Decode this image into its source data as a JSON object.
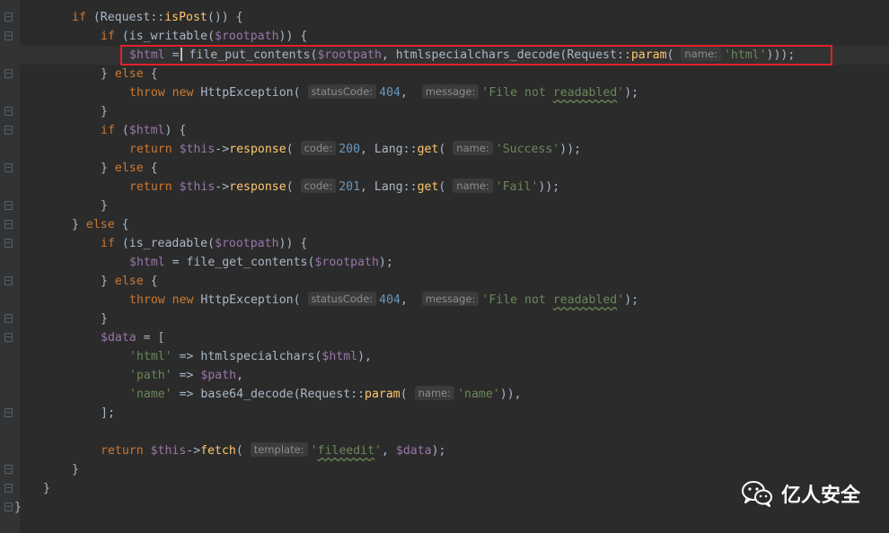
{
  "editor": {
    "lines": [
      {
        "indent": 80,
        "tokens": [
          {
            "t": "kw",
            "v": "if "
          },
          {
            "t": "plain",
            "v": "(Request::"
          },
          {
            "t": "fn",
            "v": "isPost"
          },
          {
            "t": "plain",
            "v": "()) {"
          }
        ]
      },
      {
        "indent": 112,
        "tokens": [
          {
            "t": "kw",
            "v": "if "
          },
          {
            "t": "plain",
            "v": "(is_writable("
          },
          {
            "t": "var",
            "v": "$rootpath"
          },
          {
            "t": "plain",
            "v": ")) {"
          }
        ]
      },
      {
        "indent": 144,
        "caret": true,
        "tokens": [
          {
            "t": "var",
            "v": "$html "
          },
          {
            "t": "plain",
            "v": "="
          },
          {
            "t": "caret"
          },
          {
            "t": "plain",
            "v": " file_put_contents("
          },
          {
            "t": "var",
            "v": "$rootpath"
          },
          {
            "t": "plain",
            "v": ", htmlspecialchars_decode(Request::"
          },
          {
            "t": "fn",
            "v": "param"
          },
          {
            "t": "plain",
            "v": "( "
          },
          {
            "t": "hint",
            "v": "name:"
          },
          {
            "t": "str",
            "v": "'html'"
          },
          {
            "t": "plain",
            "v": ")));"
          }
        ]
      },
      {
        "indent": 112,
        "tokens": [
          {
            "t": "plain",
            "v": "} "
          },
          {
            "t": "kw",
            "v": "else "
          },
          {
            "t": "plain",
            "v": "{"
          }
        ]
      },
      {
        "indent": 144,
        "tokens": [
          {
            "t": "kw",
            "v": "throw new "
          },
          {
            "t": "plain",
            "v": "HttpException( "
          },
          {
            "t": "hint",
            "v": "statusCode:"
          },
          {
            "t": "num",
            "v": "404"
          },
          {
            "t": "plain",
            "v": ",  "
          },
          {
            "t": "hint",
            "v": "message:"
          },
          {
            "t": "str",
            "v": "'File not "
          },
          {
            "t": "strsq",
            "v": "readabled"
          },
          {
            "t": "str",
            "v": "'"
          },
          {
            "t": "plain",
            "v": ");"
          }
        ]
      },
      {
        "indent": 112,
        "tokens": [
          {
            "t": "plain",
            "v": "}"
          }
        ]
      },
      {
        "indent": 112,
        "tokens": [
          {
            "t": "kw",
            "v": "if "
          },
          {
            "t": "plain",
            "v": "("
          },
          {
            "t": "var",
            "v": "$html"
          },
          {
            "t": "plain",
            "v": ") {"
          }
        ]
      },
      {
        "indent": 144,
        "tokens": [
          {
            "t": "kw",
            "v": "return "
          },
          {
            "t": "var",
            "v": "$this"
          },
          {
            "t": "plain",
            "v": "->"
          },
          {
            "t": "fn",
            "v": "response"
          },
          {
            "t": "plain",
            "v": "( "
          },
          {
            "t": "hint",
            "v": "code:"
          },
          {
            "t": "num",
            "v": "200"
          },
          {
            "t": "plain",
            "v": ", Lang::"
          },
          {
            "t": "fn",
            "v": "get"
          },
          {
            "t": "plain",
            "v": "( "
          },
          {
            "t": "hint",
            "v": "name:"
          },
          {
            "t": "str",
            "v": "'Success'"
          },
          {
            "t": "plain",
            "v": "));"
          }
        ]
      },
      {
        "indent": 112,
        "tokens": [
          {
            "t": "plain",
            "v": "} "
          },
          {
            "t": "kw",
            "v": "else "
          },
          {
            "t": "plain",
            "v": "{"
          }
        ]
      },
      {
        "indent": 144,
        "tokens": [
          {
            "t": "kw",
            "v": "return "
          },
          {
            "t": "var",
            "v": "$this"
          },
          {
            "t": "plain",
            "v": "->"
          },
          {
            "t": "fn",
            "v": "response"
          },
          {
            "t": "plain",
            "v": "( "
          },
          {
            "t": "hint",
            "v": "code:"
          },
          {
            "t": "num",
            "v": "201"
          },
          {
            "t": "plain",
            "v": ", Lang::"
          },
          {
            "t": "fn",
            "v": "get"
          },
          {
            "t": "plain",
            "v": "( "
          },
          {
            "t": "hint",
            "v": "name:"
          },
          {
            "t": "str",
            "v": "'Fail'"
          },
          {
            "t": "plain",
            "v": "));"
          }
        ]
      },
      {
        "indent": 112,
        "tokens": [
          {
            "t": "plain",
            "v": "}"
          }
        ]
      },
      {
        "indent": 80,
        "tokens": [
          {
            "t": "plain",
            "v": "} "
          },
          {
            "t": "kw",
            "v": "else "
          },
          {
            "t": "plain",
            "v": "{"
          }
        ]
      },
      {
        "indent": 112,
        "tokens": [
          {
            "t": "kw",
            "v": "if "
          },
          {
            "t": "plain",
            "v": "(is_readable("
          },
          {
            "t": "var",
            "v": "$rootpath"
          },
          {
            "t": "plain",
            "v": ")) {"
          }
        ]
      },
      {
        "indent": 144,
        "tokens": [
          {
            "t": "var",
            "v": "$html "
          },
          {
            "t": "plain",
            "v": "= file_get_contents("
          },
          {
            "t": "var",
            "v": "$rootpath"
          },
          {
            "t": "plain",
            "v": ");"
          }
        ]
      },
      {
        "indent": 112,
        "tokens": [
          {
            "t": "plain",
            "v": "} "
          },
          {
            "t": "kw",
            "v": "else "
          },
          {
            "t": "plain",
            "v": "{"
          }
        ]
      },
      {
        "indent": 144,
        "tokens": [
          {
            "t": "kw",
            "v": "throw new "
          },
          {
            "t": "plain",
            "v": "HttpException( "
          },
          {
            "t": "hint",
            "v": "statusCode:"
          },
          {
            "t": "num",
            "v": "404"
          },
          {
            "t": "plain",
            "v": ",  "
          },
          {
            "t": "hint",
            "v": "message:"
          },
          {
            "t": "str",
            "v": "'File not "
          },
          {
            "t": "strsq",
            "v": "readabled"
          },
          {
            "t": "str",
            "v": "'"
          },
          {
            "t": "plain",
            "v": ");"
          }
        ]
      },
      {
        "indent": 112,
        "tokens": [
          {
            "t": "plain",
            "v": "}"
          }
        ]
      },
      {
        "indent": 112,
        "tokens": [
          {
            "t": "var",
            "v": "$data "
          },
          {
            "t": "plain",
            "v": "= ["
          }
        ]
      },
      {
        "indent": 144,
        "tokens": [
          {
            "t": "str",
            "v": "'html' "
          },
          {
            "t": "plain",
            "v": "=> htmlspecialchars("
          },
          {
            "t": "var",
            "v": "$html"
          },
          {
            "t": "plain",
            "v": "),"
          }
        ]
      },
      {
        "indent": 144,
        "tokens": [
          {
            "t": "str",
            "v": "'path' "
          },
          {
            "t": "plain",
            "v": "=> "
          },
          {
            "t": "var",
            "v": "$path"
          },
          {
            "t": "plain",
            "v": ","
          }
        ]
      },
      {
        "indent": 144,
        "tokens": [
          {
            "t": "str",
            "v": "'name' "
          },
          {
            "t": "plain",
            "v": "=> base64_decode(Request::"
          },
          {
            "t": "fn",
            "v": "param"
          },
          {
            "t": "plain",
            "v": "( "
          },
          {
            "t": "hint",
            "v": "name:"
          },
          {
            "t": "str",
            "v": "'name'"
          },
          {
            "t": "plain",
            "v": ")),"
          }
        ]
      },
      {
        "indent": 112,
        "tokens": [
          {
            "t": "plain",
            "v": "];"
          }
        ]
      },
      {
        "indent": 112,
        "tokens": []
      },
      {
        "indent": 112,
        "tokens": [
          {
            "t": "kw",
            "v": "return "
          },
          {
            "t": "var",
            "v": "$this"
          },
          {
            "t": "plain",
            "v": "->"
          },
          {
            "t": "fn",
            "v": "fetch"
          },
          {
            "t": "plain",
            "v": "( "
          },
          {
            "t": "hint",
            "v": "template:"
          },
          {
            "t": "str",
            "v": "'"
          },
          {
            "t": "strsq",
            "v": "fileedit"
          },
          {
            "t": "str",
            "v": "'"
          },
          {
            "t": "plain",
            "v": ", "
          },
          {
            "t": "var",
            "v": "$data"
          },
          {
            "t": "plain",
            "v": ");"
          }
        ]
      },
      {
        "indent": 80,
        "tokens": [
          {
            "t": "plain",
            "v": "}"
          }
        ]
      },
      {
        "indent": 48,
        "tokens": [
          {
            "t": "plain",
            "v": "}"
          }
        ]
      },
      {
        "indent": 16,
        "tokens": [
          {
            "t": "plain",
            "v": "}"
          }
        ]
      }
    ],
    "fold_markers": [
      0,
      1,
      3,
      5,
      6,
      8,
      10,
      11,
      12,
      14,
      16,
      17,
      21,
      24,
      25,
      26
    ]
  },
  "watermark": {
    "text": "亿人安全",
    "icon": "wechat-icon"
  },
  "colors": {
    "background": "#2b2b2b",
    "highlight_box": "#e3222a"
  }
}
